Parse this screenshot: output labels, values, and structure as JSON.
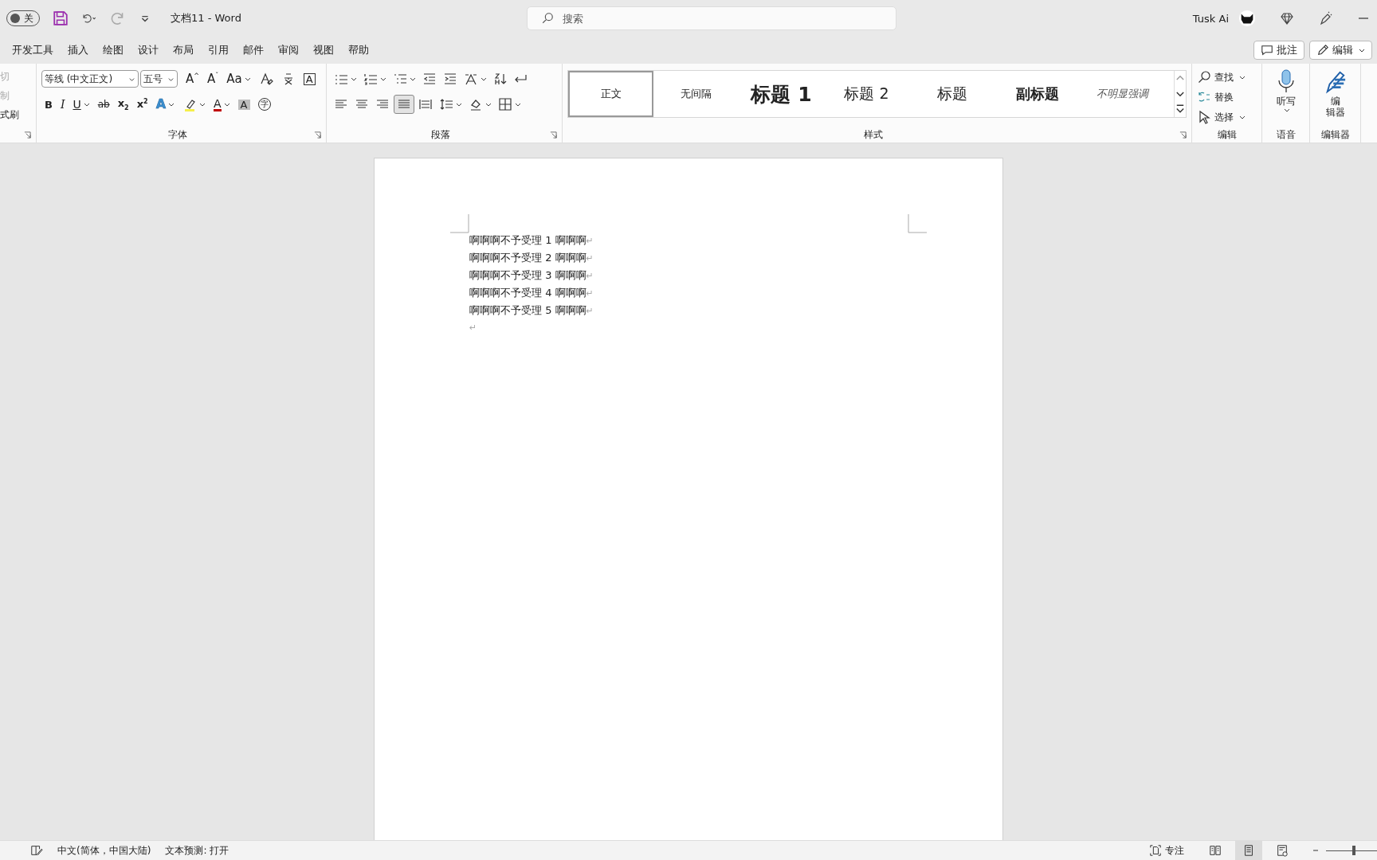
{
  "title_bar": {
    "autosave": {
      "label": "关",
      "on": false
    },
    "title": "文档11  -  Word",
    "search": {
      "placeholder": "搜索"
    },
    "user": "Tusk Ai"
  },
  "tabs": [
    {
      "label": "开发工具",
      "selected": false
    },
    {
      "label": "插入",
      "selected": false
    },
    {
      "label": "绘图",
      "selected": false
    },
    {
      "label": "设计",
      "selected": false
    },
    {
      "label": "布局",
      "selected": false
    },
    {
      "label": "引用",
      "selected": false
    },
    {
      "label": "邮件",
      "selected": false
    },
    {
      "label": "审阅",
      "selected": false
    },
    {
      "label": "视图",
      "selected": false
    },
    {
      "label": "帮助",
      "selected": false
    }
  ],
  "tab_actions": [
    {
      "label": "批注",
      "kind": "comment"
    },
    {
      "label": "编辑",
      "kind": "edit"
    }
  ],
  "clipboard": {
    "items": [
      "切",
      "制",
      "式刷"
    ]
  },
  "font": {
    "label": "字体",
    "font_name": "等线 (中文正文)",
    "font_size": "五号",
    "row1": [
      {
        "kind": "grow",
        "glyph": "A",
        "mark": "^"
      },
      {
        "kind": "shrink",
        "glyph": "A",
        "mark": "ˇ"
      },
      {
        "kind": "case",
        "glyph": "Aa",
        "caret": true
      },
      {
        "kind": "clear"
      },
      {
        "kind": "phonetic"
      },
      {
        "kind": "box",
        "glyph": "A"
      }
    ],
    "row2": [
      {
        "kind": "bold",
        "glyph": "B"
      },
      {
        "kind": "italic",
        "glyph": "I"
      },
      {
        "kind": "underline",
        "glyph": "U",
        "caret": true
      },
      {
        "kind": "strike",
        "glyph": "ab"
      },
      {
        "kind": "sub",
        "glyph": "x",
        "mark": "2"
      },
      {
        "kind": "sup",
        "glyph": "x",
        "mark": "2"
      },
      {
        "kind": "effect",
        "glyph": "A",
        "caret": true
      },
      {
        "kind": "highlight",
        "caret": true
      },
      {
        "kind": "color",
        "glyph": "A",
        "caret": true
      },
      {
        "kind": "shade",
        "glyph": "A"
      },
      {
        "kind": "circle",
        "glyph": "字"
      }
    ]
  },
  "paragraph": {
    "label": "段落",
    "row1": [
      {
        "kind": "bullets",
        "caret": true,
        "selected": false
      },
      {
        "kind": "numbering",
        "caret": true,
        "selected": false
      },
      {
        "kind": "multilevel",
        "caret": true,
        "selected": false
      },
      {
        "kind": "outdent",
        "selected": false
      },
      {
        "kind": "indent",
        "selected": false
      },
      {
        "kind": "asian",
        "caret": true,
        "selected": false
      },
      {
        "kind": "sort",
        "selected": false
      },
      {
        "kind": "marks",
        "selected": false
      }
    ],
    "row2": [
      {
        "kind": "left",
        "selected": false
      },
      {
        "kind": "center",
        "selected": false
      },
      {
        "kind": "right",
        "selected": false
      },
      {
        "kind": "justify",
        "selected": true
      },
      {
        "kind": "distribute",
        "selected": false
      },
      {
        "kind": "spacing",
        "caret": true,
        "selected": false
      },
      {
        "kind": "shading",
        "caret": true,
        "selected": false
      },
      {
        "kind": "borders",
        "caret": true,
        "selected": false
      }
    ]
  },
  "styles": {
    "label": "样式",
    "items": [
      {
        "label": "正文",
        "kind": "normal",
        "selected": true
      },
      {
        "label": "无间隔",
        "kind": "normal",
        "selected": false
      },
      {
        "label": "标题 1",
        "kind": "h1",
        "selected": false
      },
      {
        "label": "标题 2",
        "kind": "h2",
        "selected": false
      },
      {
        "label": "标题",
        "kind": "title",
        "selected": false
      },
      {
        "label": "副标题",
        "kind": "subtitle",
        "selected": false
      },
      {
        "label": "不明显强调",
        "kind": "emphasis",
        "selected": false
      }
    ]
  },
  "editing": {
    "label": "编辑",
    "items": [
      {
        "label": "查找",
        "kind": "find",
        "caret": true
      },
      {
        "label": "替换",
        "kind": "replace"
      },
      {
        "label": "选择",
        "kind": "select",
        "caret": true
      }
    ]
  },
  "voice": {
    "label": "语音",
    "button": "听写"
  },
  "editor": {
    "label": "编辑器",
    "button_lines": [
      "编",
      "辑器"
    ]
  },
  "document": {
    "paragraphs": [
      "啊啊啊不予受理 1 啊啊啊",
      "啊啊啊不予受理 2 啊啊啊",
      "啊啊啊不予受理 3 啊啊啊",
      "啊啊啊不予受理 4 啊啊啊",
      "啊啊啊不予受理 5 啊啊啊"
    ],
    "paragraph_mark": "↵"
  },
  "status_bar": {
    "language": "中文(简体，中国大陆)",
    "prediction": "文本预测: 打开",
    "focus": "专注",
    "views": [
      {
        "kind": "read",
        "selected": false
      },
      {
        "kind": "print",
        "selected": true
      },
      {
        "kind": "web",
        "selected": false
      }
    ],
    "zoom": {
      "level": 0.55
    }
  }
}
